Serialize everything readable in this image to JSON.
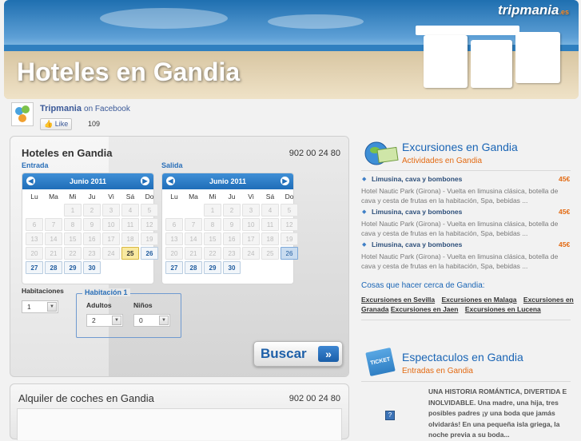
{
  "banner": {
    "title": "Hoteles en Gandia",
    "brand": "tripmania",
    "brand_suffix": ".es"
  },
  "facebook": {
    "name": "Tripmania",
    "on": "on Facebook",
    "like_label": "Like",
    "count": "109"
  },
  "hotel_search": {
    "title": "Hoteles en Gandia",
    "phone": "902 00 24 80",
    "entrada_label": "Entrada",
    "salida_label": "Salida",
    "weekdays": [
      "Lu",
      "Ma",
      "Mi",
      "Ju",
      "Vi",
      "Sá",
      "Do"
    ],
    "calendars": [
      {
        "month": "Junio 2011",
        "highlight": "25",
        "selected": ""
      },
      {
        "month": "Junio 2011",
        "highlight": "",
        "selected": "26"
      }
    ],
    "rows": [
      [
        "",
        "",
        "1",
        "2",
        "3",
        "4",
        "5"
      ],
      [
        "6",
        "7",
        "8",
        "9",
        "10",
        "11",
        "12"
      ],
      [
        "13",
        "14",
        "15",
        "16",
        "17",
        "18",
        "19"
      ],
      [
        "20",
        "21",
        "22",
        "23",
        "24",
        "25",
        "26"
      ],
      [
        "27",
        "28",
        "29",
        "30",
        "",
        "",
        ""
      ]
    ],
    "habitaciones_label": "Habitaciones",
    "habitaciones_value": "1",
    "room_legend": "Habitación 1",
    "adultos_label": "Adultos",
    "adultos_value": "2",
    "ninos_label": "Niños",
    "ninos_value": "0",
    "buscar_label": "Buscar"
  },
  "car_rental": {
    "title": "Alquiler de coches en Gandia",
    "phone": "902 00 24 80"
  },
  "excursiones": {
    "title": "Excursiones en Gandia",
    "subtitle": "Actividades en Gandia",
    "items": [
      {
        "name": "Limusina, cava y bombones",
        "price": "45€",
        "desc": "Hotel Nautic Park (Girona) - Vuelta en limusina clásica, botella de cava y cesta de frutas en la habitación, Spa, bebidas ..."
      },
      {
        "name": "Limusina, cava y bombones",
        "price": "45€",
        "desc": "Hotel Nautic Park (Girona) - Vuelta en limusina clásica, botella de cava y cesta de frutas en la habitación, Spa, bebidas ..."
      },
      {
        "name": "Limusina, cava y bombones",
        "price": "45€",
        "desc": "Hotel Nautic Park (Girona) - Vuelta en limusina clásica, botella de cava y cesta de frutas en la habitación, Spa, bebidas ..."
      }
    ],
    "cosas_title": "Cosas que hacer cerca de Gandia:",
    "links": [
      "Excursiones en Sevilla",
      "Excursiones en Malaga",
      "Excursiones en Granada",
      "Excursiones en Jaen",
      "Excursiones en Lucena"
    ]
  },
  "espectaculos": {
    "title": "Espectaculos en Gandia",
    "subtitle": "Entradas en Gandia",
    "ticket_label": "TICKET",
    "description": "UNA HISTORIA ROMÁNTICA, DIVERTIDA E INOLVIDABLE. Una madre, una hija, tres posibles padres ¡y una boda que jamás olvidarás! En una pequeña isla griega, la noche previa a su boda..."
  }
}
